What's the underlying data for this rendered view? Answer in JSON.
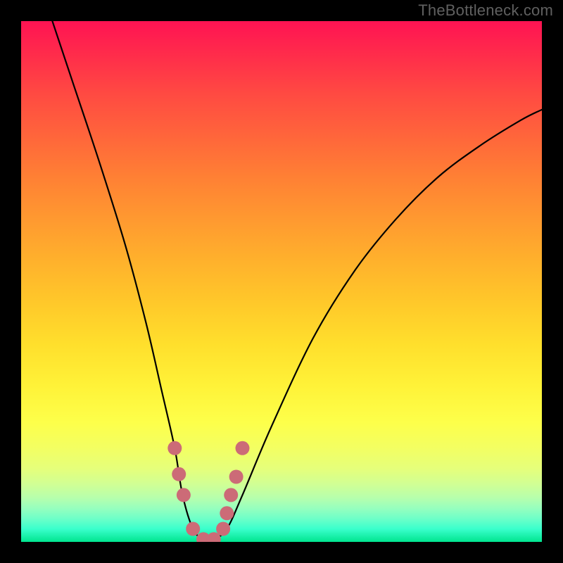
{
  "credit_text": "TheBottleneck.com",
  "chart_data": {
    "type": "line",
    "title": "",
    "xlabel": "",
    "ylabel": "",
    "xlim": [
      0,
      100
    ],
    "ylim": [
      0,
      100
    ],
    "series": [
      {
        "name": "bottleneck-curve",
        "x": [
          6,
          10,
          15,
          20,
          24,
          27,
          29.5,
          31,
          33,
          35,
          37,
          39.5,
          42.5,
          48,
          56,
          64,
          72,
          80,
          88,
          96,
          100
        ],
        "y": [
          100,
          88,
          73,
          57,
          42,
          29,
          18,
          9,
          2.5,
          0.5,
          0.5,
          2.5,
          9,
          22,
          39,
          52,
          62,
          70,
          76,
          81,
          83
        ]
      }
    ],
    "markers": {
      "name": "highlight-dots",
      "x": [
        29.5,
        30.3,
        31.2,
        33,
        35,
        37,
        38.8,
        39.5,
        40.3,
        41.3,
        42.5
      ],
      "y": [
        18,
        13,
        9,
        2.5,
        0.5,
        0.5,
        2.5,
        5.5,
        9,
        12.5,
        18
      ],
      "color": "#cc6b77",
      "radius": 10
    },
    "background_gradient": {
      "top": "#ff1353",
      "mid": "#ffe22e",
      "bottom": "#00e58f"
    }
  }
}
